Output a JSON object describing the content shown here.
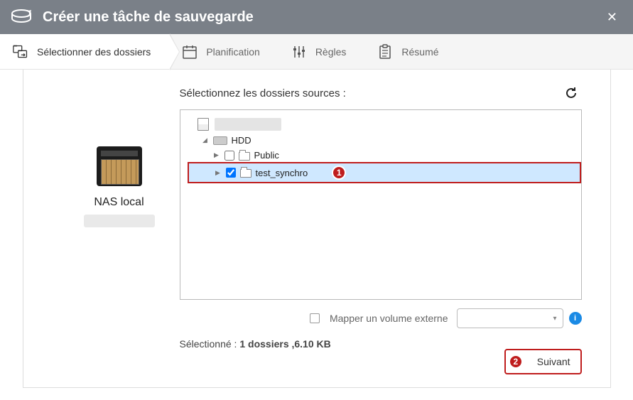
{
  "window": {
    "title": "Créer une tâche de sauvegarde"
  },
  "steps": [
    {
      "key": "select",
      "label": "Sélectionner des dossiers"
    },
    {
      "key": "plan",
      "label": "Planification"
    },
    {
      "key": "rules",
      "label": "Règles"
    },
    {
      "key": "summary",
      "label": "Résumé"
    }
  ],
  "nas": {
    "label": "NAS local"
  },
  "source": {
    "prompt": "Sélectionnez les dossiers sources :",
    "hdd_label": "HDD",
    "folders": [
      {
        "name": "Public",
        "checked": false
      },
      {
        "name": "test_synchro",
        "checked": true
      }
    ]
  },
  "map": {
    "label": "Mapper un volume externe"
  },
  "selection": {
    "prefix": "Sélectionné : ",
    "detail": "1 dossiers ,6.10 KB"
  },
  "actions": {
    "next": "Suivant"
  },
  "callouts": {
    "row": "1",
    "button": "2"
  }
}
